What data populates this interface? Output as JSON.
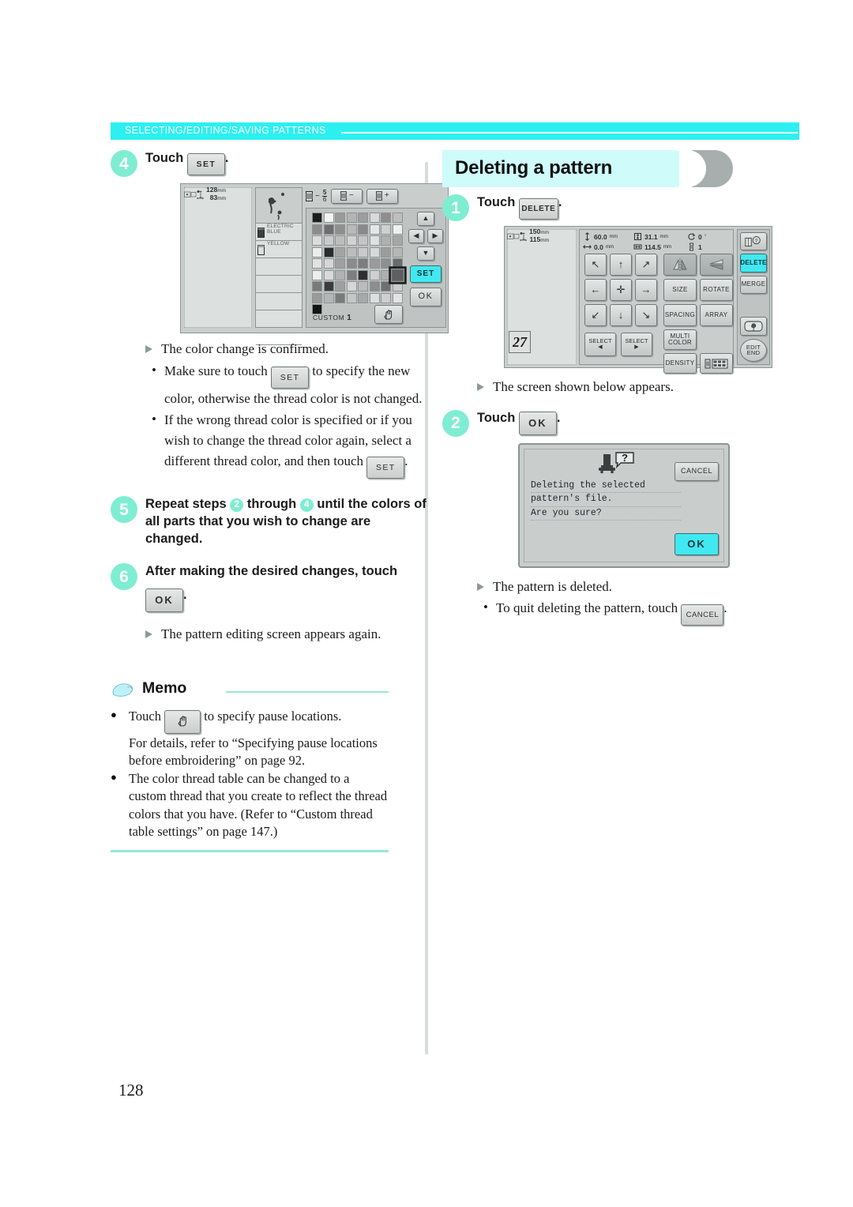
{
  "header": {
    "running_title": "SELECTING/EDITING/SAVING PATTERNS"
  },
  "page_number": "128",
  "left_column": {
    "step4": {
      "number": "4",
      "text_before": "Touch",
      "key_label": "SET",
      "text_after": "."
    },
    "screen_a": {
      "hoop_width": "128",
      "hoop_height": "83",
      "unit": "mm",
      "color_step_current": "5",
      "color_step_total": "6",
      "spool_minus": "−",
      "spool_plus": "+",
      "thread_colors": [
        "ELECTRIC BLUE",
        "YELLOW"
      ],
      "custom_label": "CUSTOM",
      "custom_number": "1",
      "nav_up": "▲",
      "nav_left": "◀",
      "nav_right": "▶",
      "nav_down": "▼",
      "set_label": "SET",
      "ok_label": "OK",
      "hand_icon": "hand-icon",
      "palette_rows": [
        [
          "#1c1c1c",
          "#f2f2f2",
          "#9a9a9a",
          "#b4b4b4",
          "#9d9d9d",
          "#d9d9d9",
          "#8e8e8e",
          "#bfbfbf"
        ],
        [
          "#8c8c8c",
          "#6e6e6e",
          "#8f8f8f",
          "#b9b9b9",
          "#8a8a8a",
          "#e6e6e6",
          "#cfcfcf",
          "#f0f0f0"
        ],
        [
          "#dcdcdc",
          "#cacaca",
          "#bdbdbd",
          "#d2d2d2",
          "#c4c4c4",
          "#e0e0e0",
          "#b0b0b0",
          "#a7a7a7"
        ],
        [
          "#ececec",
          "#2b2b2b",
          "#a3a3a3",
          "#bdbdbd",
          "#cacaca",
          "#d8d8d8",
          "#9c9c9c",
          "#b6b6b6"
        ],
        [
          "#e2e2e2",
          "#d6d6d6",
          "#a0a0a0",
          "#8b8b8b",
          "#7d7d7d",
          "#9b9b9b",
          "#8f8f8f",
          "#6b6b6b"
        ],
        [
          "#ededed",
          "#dadada",
          "#b2b2b2",
          "#7e7e7e",
          "#2f2f2f",
          "#cfcfcf",
          "#aeaeae",
          "#5f5f5f"
        ],
        [
          "#7a7a7a",
          "#3b3b3b",
          "#9f9f9f",
          "#d7d7d7",
          "#bcbcbc",
          "#8d8d8d",
          "#6f6f6f",
          "#cccccc"
        ],
        [
          "#9a9a9a",
          "#b5b5b5",
          "#7b7b7b",
          "#c6c6c6",
          "#a8a8a8",
          "#dedede",
          "#cfcfcf",
          "#e4e4e4"
        ],
        [
          "#141414"
        ]
      ],
      "selected_swatch": {
        "row": 5,
        "col": 7
      }
    },
    "result1": "The color change is confirmed.",
    "note1": {
      "part1": "Make sure to touch",
      "key": "SET",
      "part2": "to specify the new color, otherwise the thread color is not changed."
    },
    "note2": {
      "part1": "If the wrong thread color is specified or if you wish to change the thread color again, select a different thread color, and then touch",
      "key": "SET",
      "part2": "."
    },
    "step5": {
      "number": "5",
      "text_part1": "Repeat steps",
      "ref1": "2",
      "text_part2": "through",
      "ref2": "4",
      "text_part3": "until the colors of all parts that you wish to change are changed."
    },
    "step6": {
      "number": "6",
      "text": "After making the desired changes, touch",
      "key_label": "OK",
      "text_after": "."
    },
    "result2": "The pattern editing screen appears again.",
    "memo": {
      "title": "Memo",
      "item1_part1": "Touch",
      "item1_key": "hand-icon",
      "item1_part2": "to specify pause locations.",
      "item1_sub": "For details, refer to “Specifying pause locations before embroidering” on page 92.",
      "item2": "The color thread table can be changed to a custom thread that you create to reflect the thread colors that you have. (Refer to “Custom thread table settings” on page 147.)"
    }
  },
  "right_column": {
    "section_title": "Deleting a pattern",
    "step1": {
      "number": "1",
      "text_before": "Touch",
      "key_label": "DELETE",
      "text_after": "."
    },
    "screen_b": {
      "hoop_width": "150",
      "hoop_height": "115",
      "unit": "mm",
      "readout": [
        {
          "icon": "vertical-position-icon",
          "value": "60.0",
          "unit": "mm"
        },
        {
          "icon": "size-icon",
          "value": "31.1",
          "unit": "mm"
        },
        {
          "icon": "rotate-icon",
          "value": "0",
          "unit": "°"
        },
        {
          "icon": "horizontal-position-icon",
          "value": "0.0",
          "unit": "mm"
        },
        {
          "icon": "width-icon",
          "value": "114.5",
          "unit": "mm"
        },
        {
          "icon": "spool-icon",
          "value": "1",
          "unit": ""
        }
      ],
      "arrows": [
        "↖",
        "↑",
        "↗",
        "←",
        "✛",
        "→",
        "↙",
        "↓",
        "↘"
      ],
      "functions": [
        "",
        "",
        "SIZE",
        "ROTATE",
        "SPACING",
        "ARRAY"
      ],
      "mirror_v_icon": "mirror-vertical-icon",
      "mirror_h_icon": "mirror-horizontal-icon",
      "select_prev": "SELECT",
      "select_next": "SELECT",
      "select_prev_arrow": "◀",
      "select_next_arrow": "▶",
      "multi_color": "MULTI COLOR",
      "density": "DENSITY",
      "thread_palette_icon": "thread-palette-icon",
      "side_buttons": {
        "guide_icon": "guide-book-icon",
        "delete": "DELETE",
        "merge": "MERGE",
        "preview_icon": "preview-icon",
        "edit_end": "EDIT END"
      },
      "pattern_glyph": "27"
    },
    "result1": "The screen shown below appears.",
    "step2": {
      "number": "2",
      "text_before": "Touch",
      "key_label": "OK",
      "text_after": "."
    },
    "screen_c": {
      "icon": "machine-question-icon",
      "message_lines": [
        "Deleting the selected",
        "pattern's file.",
        "Are you sure?"
      ],
      "cancel_label": "CANCEL",
      "ok_label": "OK"
    },
    "result2": "The pattern is deleted.",
    "note1": {
      "part1": "To quit deleting the pattern, touch",
      "key": "CANCEL",
      "part2": "."
    }
  },
  "colors": {
    "banner_cyan": "#2CF0F0",
    "step_circle": "#7FEDD2",
    "heading_bg": "#CFFBFB",
    "lcd_bg": "#C9CECD",
    "lcd_highlight": "#42E8F0"
  }
}
